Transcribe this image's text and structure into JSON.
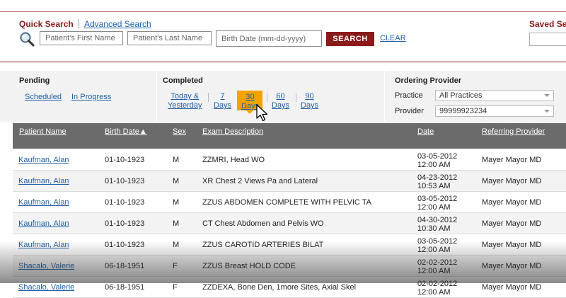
{
  "quick_search": {
    "title": "Quick Search",
    "advanced_link": "Advanced Search",
    "first_name_placeholder": "Patient's First Name",
    "last_name_placeholder": "Patient's Last Name",
    "birth_date_placeholder": "Birth Date (mm-dd-yyyy)",
    "search_label": "SEARCH",
    "clear_label": "CLEAR",
    "saved_title": "Saved Se"
  },
  "filters": {
    "pending": {
      "label": "Pending",
      "links": [
        "Scheduled",
        "In Progress"
      ]
    },
    "completed": {
      "label": "Completed",
      "links": [
        {
          "line1": "Today &",
          "line2": "Yesterday"
        },
        {
          "line1": "7",
          "line2": "Days"
        },
        {
          "line1": "30",
          "line2": "Days",
          "selected": true
        },
        {
          "line1": "60",
          "line2": "Days"
        },
        {
          "line1": "90",
          "line2": "Days"
        }
      ]
    },
    "ordering_provider": {
      "label": "Ordering Provider",
      "practice_label": "Practice",
      "practice_value": "All Practices",
      "provider_label": "Provider",
      "provider_value": "99999923234"
    }
  },
  "table": {
    "columns": [
      "Patient Name",
      "Birth Date▲",
      "Sex",
      "Exam Description",
      "Date",
      "Referring Provider"
    ],
    "rows": [
      {
        "name": "Kaufman, Alan",
        "birth": "01-10-1923",
        "sex": "M",
        "exam": "ZZMRI, Head WO",
        "date": "03-05-2012",
        "time": "12:00 AM",
        "provider": "Mayer Mayor MD"
      },
      {
        "name": "Kaufman, Alan",
        "birth": "01-10-1923",
        "sex": "M",
        "exam": "XR Chest 2 Views Pa and Lateral",
        "date": "04-23-2012",
        "time": "10:53 AM",
        "provider": "Mayer Mayor MD"
      },
      {
        "name": "Kaufman, Alan",
        "birth": "01-10-1923",
        "sex": "M",
        "exam": "ZZUS ABDOMEN COMPLETE WITH PELVIC TA",
        "date": "03-05-2012",
        "time": "12:00 AM",
        "provider": "Mayer Mayor MD"
      },
      {
        "name": "Kaufman, Alan",
        "birth": "01-10-1923",
        "sex": "M",
        "exam": "CT Chest Abdomen and Pelvis WO",
        "date": "04-30-2012",
        "time": "10:30 AM",
        "provider": "Mayer Mayor MD"
      },
      {
        "name": "Kaufman, Alan",
        "birth": "01-10-1923",
        "sex": "M",
        "exam": "ZZUS CAROTID ARTERIES BILAT",
        "date": "03-05-2012",
        "time": "12:00 AM",
        "provider": "Mayer Mayor MD"
      },
      {
        "name": "Shacalo, Valerie",
        "birth": "06-18-1951",
        "sex": "F",
        "exam": "ZZUS Breast HOLD CODE",
        "date": "02-02-2012",
        "time": "12:00 AM",
        "provider": "Mayer Mayor MD"
      },
      {
        "name": "Shacalo, Valerie",
        "birth": "06-18-1951",
        "sex": "F",
        "exam": "ZZDEXA, Bone Den, 1more Sites, Axial Skel",
        "date": "02-02-2012",
        "time": "12:00 AM",
        "provider": "Mayer Mayor MD"
      }
    ]
  },
  "colors": {
    "brand_red": "#8b1a1a",
    "link_blue": "#1f5fa8",
    "highlight": "#f5a100",
    "header_gray": "#6b6b6b"
  },
  "icons": {
    "search": "magnifier-icon",
    "cursor": "arrow-cursor-icon"
  }
}
